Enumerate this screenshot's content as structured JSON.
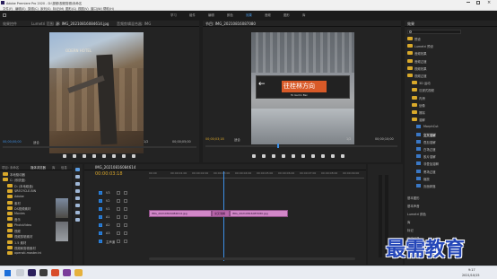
{
  "titlebar": {
    "title": "Adobe Premiere Pro 2020 - D:\\视频\\视频剪辑\\未命名",
    "menus": [
      "文件(F)",
      "编辑(E)",
      "剪辑(C)",
      "序列(S)",
      "标记(M)",
      "图形(G)",
      "视图(V)",
      "窗口(W)",
      "帮助(H)"
    ]
  },
  "workspaces": [
    "学习",
    "组件",
    "编辑",
    "颜色",
    "效果",
    "音频",
    "图形",
    "库"
  ],
  "source_panel": {
    "tabs": [
      "效果控件",
      "Lumetri 范围",
      "源: IMG_20210816084614.jpg",
      "音频剪辑混合器: IMG"
    ],
    "timecode_left": "00;00;00;00",
    "fit_label": "适合",
    "scale": "1/2",
    "timecode_right": "00;00;05;00",
    "scene_text": "ODERN HOTEL"
  },
  "program_panel": {
    "tab": "节目: IMG_20210816087080",
    "timecode_left": "00;00;03;18",
    "fit_label": "适合",
    "scale": "1/2",
    "timecode_right": "00;00;10;00",
    "sign_text": "往桂林方向",
    "sign_sub": "To Guilin Bei"
  },
  "project_panel": {
    "tabs": [
      "项目: 未命名",
      "媒体浏览器",
      "库",
      "信息"
    ],
    "tree": [
      "本地驱动器",
      "C: (系统盘)",
      "D: (本地磁盘)",
      "$RECYCLE.BIN",
      "Adobe",
      "素材",
      "DS视频素材",
      "Movies",
      "音乐",
      "PhotoVideo",
      "视频",
      "视频剪辑素材",
      "1.5 素材",
      "视频和剪辑素材",
      "opensti.master.ini"
    ]
  },
  "timeline": {
    "tab": "IMG_20210816084614",
    "timecode": "00:00:03:18",
    "ruler": [
      "00:00",
      "00:00:01:00",
      "00:00:02:00",
      "00:00:03:00",
      "00:00:04:00",
      "00:00:05:00",
      "00:00:06:00",
      "00:00:07:00",
      "00:00:08:00",
      "00:00:09:00"
    ],
    "track_labels": [
      "V3",
      "V2",
      "V1",
      "A1",
      "A2",
      "A3",
      "主声道"
    ],
    "clips": [
      {
        "label": "IMG_20210816084614.jpg",
        "color": "#d287c8"
      },
      {
        "label": "交叉溶解",
        "color": "#b764a8"
      },
      {
        "label": "IMG_20210816087080.jpg",
        "color": "#d287c8"
      }
    ]
  },
  "effects_panel": {
    "tabs": [
      "效果"
    ],
    "items": [
      "预设",
      "Lumetri 预设",
      "音频效果",
      "音频过渡",
      "视频效果",
      "视频过渡",
      "3D 运动",
      "沉浸式视频",
      "内滑",
      "划像",
      "擦除",
      "溶解",
      "MorphCut",
      "交叉溶解",
      "叠加溶解",
      "白场过渡",
      "胶片溶解",
      "非叠加溶解",
      "黑场过渡",
      "缩放",
      "页面剥落"
    ],
    "lower": [
      "基本图形",
      "基本声音",
      "Lumetri 颜色",
      "库",
      "标记",
      "历史记录",
      "信息"
    ]
  },
  "watermark": "最需教育",
  "taskbar": {
    "time": "9:17",
    "date": "2021/10/15"
  }
}
